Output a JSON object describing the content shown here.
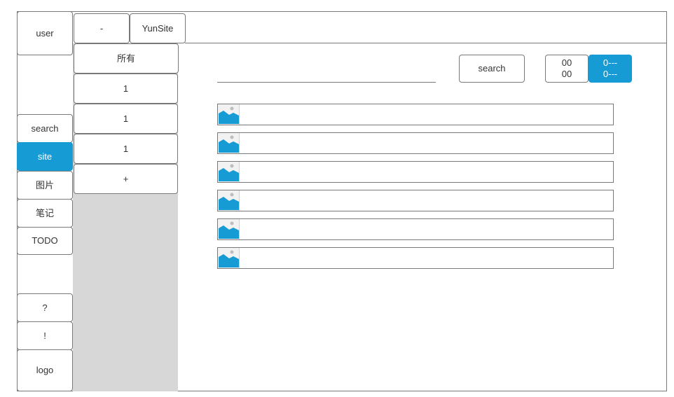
{
  "sidebar": {
    "user": "user",
    "items": [
      {
        "label": "search",
        "active": false
      },
      {
        "label": "site",
        "active": true
      },
      {
        "label": "图片",
        "active": false
      },
      {
        "label": "笔记",
        "active": false
      },
      {
        "label": "TODO",
        "active": false
      }
    ],
    "help": "?",
    "alert": "!",
    "logo": "logo"
  },
  "topbar": {
    "minus": "-",
    "title": "YunSite"
  },
  "categories": {
    "all": "所有",
    "items": [
      "1",
      "1",
      "1"
    ],
    "add": "+"
  },
  "main": {
    "search_value": "",
    "search_button": "search",
    "counter": {
      "line1": "00",
      "line2": "00"
    },
    "counter_active": {
      "line1": "0---",
      "line2": "0---"
    },
    "rows": [
      {
        "icon": "image-placeholder-icon",
        "text": ""
      },
      {
        "icon": "image-placeholder-icon",
        "text": ""
      },
      {
        "icon": "image-placeholder-icon",
        "text": ""
      },
      {
        "icon": "image-placeholder-icon",
        "text": ""
      },
      {
        "icon": "image-placeholder-icon",
        "text": ""
      },
      {
        "icon": "image-placeholder-icon",
        "text": ""
      }
    ]
  },
  "colors": {
    "accent": "#169bd5",
    "border": "#797979",
    "panel_gray": "#d7d7d7"
  }
}
